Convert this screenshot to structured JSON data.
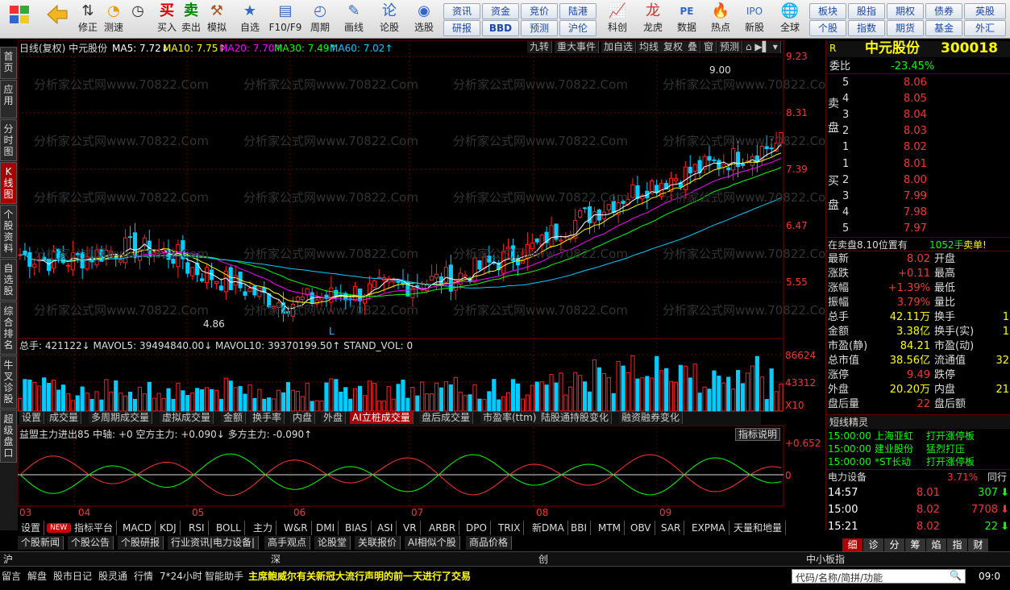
{
  "toolbar": {
    "buttons": [
      {
        "label": "",
        "icon": "windows-icon"
      },
      {
        "label": "",
        "icon": "back-arrow-icon"
      },
      {
        "label": "修正",
        "icon": "adjust-icon"
      },
      {
        "label": "测速",
        "icon": "speed-icon"
      },
      {
        "label": "买入",
        "icon": "buy-icon"
      },
      {
        "label": "卖出",
        "icon": "sell-icon"
      },
      {
        "label": "模拟",
        "icon": "hammer-icon"
      },
      {
        "label": "自选",
        "icon": "star-icon"
      },
      {
        "label": "F10/F9",
        "icon": "f10-icon"
      },
      {
        "label": "周期",
        "icon": "clock-icon"
      },
      {
        "label": "画线",
        "icon": "pencil-icon"
      },
      {
        "label": "论股",
        "icon": "chat-icon"
      },
      {
        "label": "选股",
        "icon": "select-icon"
      }
    ],
    "textbuttons": [
      "资讯",
      "资金",
      "竞价",
      "陆港",
      "研报",
      "BBD",
      "预测",
      "沪伦"
    ],
    "right_buttons": [
      {
        "label": "科创",
        "icon": "chart-icon"
      },
      {
        "label": "龙虎",
        "icon": "dragon-icon"
      },
      {
        "label": "数据",
        "icon": "pe-icon"
      },
      {
        "label": "热点",
        "icon": "hot-icon"
      },
      {
        "label": "新股",
        "icon": "ipo-icon"
      },
      {
        "label": "全球",
        "icon": "globe-icon"
      }
    ],
    "right_textbuttons": [
      "板块",
      "股指",
      "期权",
      "债券",
      "英股",
      "个股",
      "指数",
      "期货",
      "基金",
      "外汇"
    ]
  },
  "sidebar": [
    "首页",
    "应用",
    "分时图",
    "K线图",
    "个股资料",
    "自选股",
    "综合排名",
    "牛叉诊股",
    "超级盘口"
  ],
  "chart": {
    "header": "日线(复权)  中元股份",
    "ma5": "MA5: 7.72↓",
    "ma10": "MA10: 7.75↑",
    "ma20": "MA20: 7.70↑",
    "ma30": "MA30: 7.49↑",
    "ma60": "MA60: 7.02↑",
    "top_tabs": [
      "九转",
      "重大事件",
      "加自选",
      "均线",
      "复权",
      "叠",
      "窗",
      "预测"
    ],
    "y_labels": [
      "9.23",
      "8.31",
      "7.39",
      "6.47",
      "5.55"
    ],
    "max_label": "9.00",
    "min_label": "4.86",
    "l_marker": "L",
    "watermark": "分析家公式网www.70822.Com",
    "vol_header": "总手: 421122↓  MAVOL5: 39494840.00↓  MAVOL10: 39370199.50↑  STAND_VOL: 0",
    "vol_labels": [
      "86624",
      "43312",
      "X10"
    ],
    "vol_tabs": [
      "设置",
      "成交量",
      "多周期成交量",
      "虚拟成交量",
      "金额",
      "换手率",
      "内盘",
      "外盘",
      "AI立桩成交量",
      "盘后成交量",
      "市盈率(ttm)",
      "陆股通持股变化",
      "融资融券变化"
    ],
    "ind_header": "益盟主力进出85  中轴: +0  空方主力: +0.090↓  多方主力: -0.090↑",
    "ind_help": "指标说明",
    "ind_labels": [
      "+0.652",
      "0"
    ],
    "x_labels": [
      "03",
      "04",
      "05",
      "06",
      "07",
      "08",
      "09"
    ]
  },
  "chart_data": {
    "type": "candlestick",
    "y_ticks": [
      "9.23",
      "8.31",
      "7.39",
      "6.47",
      "5.55"
    ],
    "volume_ticks": [
      "86624",
      "43312"
    ],
    "x_ticks": [
      "03",
      "04",
      "05",
      "06",
      "07",
      "08",
      "09"
    ],
    "ma": [
      {
        "name": "MA5",
        "value": 7.72
      },
      {
        "name": "MA10",
        "value": 7.75
      },
      {
        "name": "MA20",
        "value": 7.7
      },
      {
        "name": "MA30",
        "value": 7.49
      },
      {
        "name": "MA60",
        "value": 7.02
      }
    ],
    "high": 9.0,
    "low": 4.86
  },
  "indicator_tabs": [
    "设置",
    "NEW",
    "指标平台",
    "MACD",
    "KDJ",
    "RSI",
    "BOLL",
    "主力",
    "W&R",
    "DMI",
    "BIAS",
    "ASI",
    "VR",
    "ARBR",
    "DPO",
    "TRIX",
    "新DMA",
    "BBI",
    "MTM",
    "OBV",
    "SAR",
    "EXPMA",
    "天量和地量"
  ],
  "info_tabs": [
    "个股新闻",
    "个股公告",
    "个股研报",
    "行业资讯|电力设备|",
    "高手观点",
    "论股堂",
    "关联报价",
    "AI相似个股",
    "商品价格"
  ],
  "market_bar": {
    "sh": "沪",
    "sz": "深",
    "cy": "创",
    "zx": "中小板指"
  },
  "right": {
    "r": "R",
    "name": "中元股份",
    "code": "300018",
    "weibi_label": "委比",
    "weibi": "-23.45%",
    "sell_label": "卖盘",
    "buy_label": "买盘",
    "asks": [
      {
        "n": "5",
        "p": "8.06"
      },
      {
        "n": "4",
        "p": "8.05"
      },
      {
        "n": "3",
        "p": "8.04"
      },
      {
        "n": "2",
        "p": "8.03"
      },
      {
        "n": "1",
        "p": "8.02"
      }
    ],
    "bids": [
      {
        "n": "1",
        "p": "8.01"
      },
      {
        "n": "2",
        "p": "8.00"
      },
      {
        "n": "3",
        "p": "7.99"
      },
      {
        "n": "4",
        "p": "7.98"
      },
      {
        "n": "5",
        "p": "7.97"
      }
    ],
    "alert": "在卖盘8.10位置有",
    "alert_vol": "1052手",
    "alert_type": "卖单!",
    "stats": [
      {
        "l": "最新",
        "v": "8.02",
        "l2": "开盘"
      },
      {
        "l": "涨跌",
        "v": "+0.11",
        "l2": "最高"
      },
      {
        "l": "涨幅",
        "v": "+1.39%",
        "l2": "最低"
      },
      {
        "l": "振幅",
        "v": "3.79%",
        "l2": "量比"
      },
      {
        "l": "总手",
        "v": "42.11万",
        "l2": "换手",
        "v2": "1"
      },
      {
        "l": "金额",
        "v": "3.38亿",
        "l2": "换手(实)",
        "v2": "1"
      },
      {
        "l": "市盈(静)",
        "v": "84.21",
        "l2": "市盈(动)"
      },
      {
        "l": "总市值",
        "v": "38.56亿",
        "l2": "流通值",
        "v2": "32"
      },
      {
        "l": "涨停",
        "v": "9.49",
        "l2": "跌停"
      },
      {
        "l": "外盘",
        "v": "20.20万",
        "l2": "内盘",
        "v2": "21"
      },
      {
        "l": "盘后量",
        "v": "22",
        "l2": "盘后额"
      }
    ],
    "short_title": "短线精灵",
    "shorts": [
      {
        "t": "15:00:00",
        "n": "上海亚虹",
        "e": "打开涨停板"
      },
      {
        "t": "15:00:00",
        "n": "建业股份",
        "e": "猛烈打压"
      },
      {
        "t": "15:00:00",
        "n": "*ST长动",
        "e": "打开涨停板"
      }
    ],
    "sector": "电力设备",
    "sector_pct": "3.71%",
    "sector_btn": "同行",
    "ticks": [
      {
        "t": "14:57",
        "p": "8.01",
        "v": "307"
      },
      {
        "t": "15:00",
        "p": "8.02",
        "v": "7708"
      },
      {
        "t": "15:21",
        "p": "8.02",
        "v": "22"
      }
    ],
    "bottom_tabs": [
      "细",
      "诊",
      "分",
      "筹",
      "焰",
      "指",
      "财"
    ]
  },
  "status": {
    "items": [
      "留言",
      "解盘",
      "股市日记",
      "股灵通",
      "行情",
      "7*24小时",
      "智能助手"
    ],
    "news": "主席鲍威尔有关新冠大流行声明的前一天进行了交易",
    "search_placeholder": "代码/名称/简拼/功能",
    "time": "09:0"
  }
}
